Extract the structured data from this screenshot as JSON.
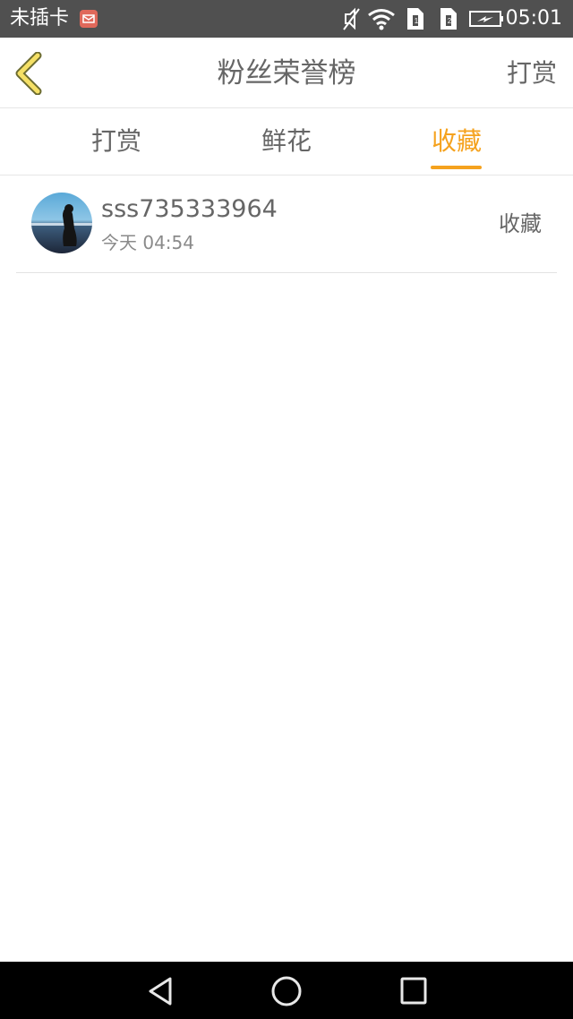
{
  "status_bar": {
    "carrier": "未插卡",
    "time": "05:01",
    "icons": [
      "mail-notification-icon",
      "mute-icon",
      "wifi-icon",
      "sim1-icon",
      "sim2-icon",
      "battery-icon"
    ]
  },
  "header": {
    "title": "粉丝荣誉榜",
    "right_action": "打赏"
  },
  "tabs": [
    {
      "label": "打赏",
      "active": false
    },
    {
      "label": "鲜花",
      "active": false
    },
    {
      "label": "收藏",
      "active": true
    }
  ],
  "list": [
    {
      "username": "sss735333964",
      "time": "今天 04:54",
      "action": "收藏"
    }
  ],
  "colors": {
    "accent": "#f5a21e",
    "status_bar": "#505050",
    "text": "#666666"
  },
  "nav_bar": [
    "back-triangle-icon",
    "home-circle-icon",
    "recents-square-icon"
  ]
}
